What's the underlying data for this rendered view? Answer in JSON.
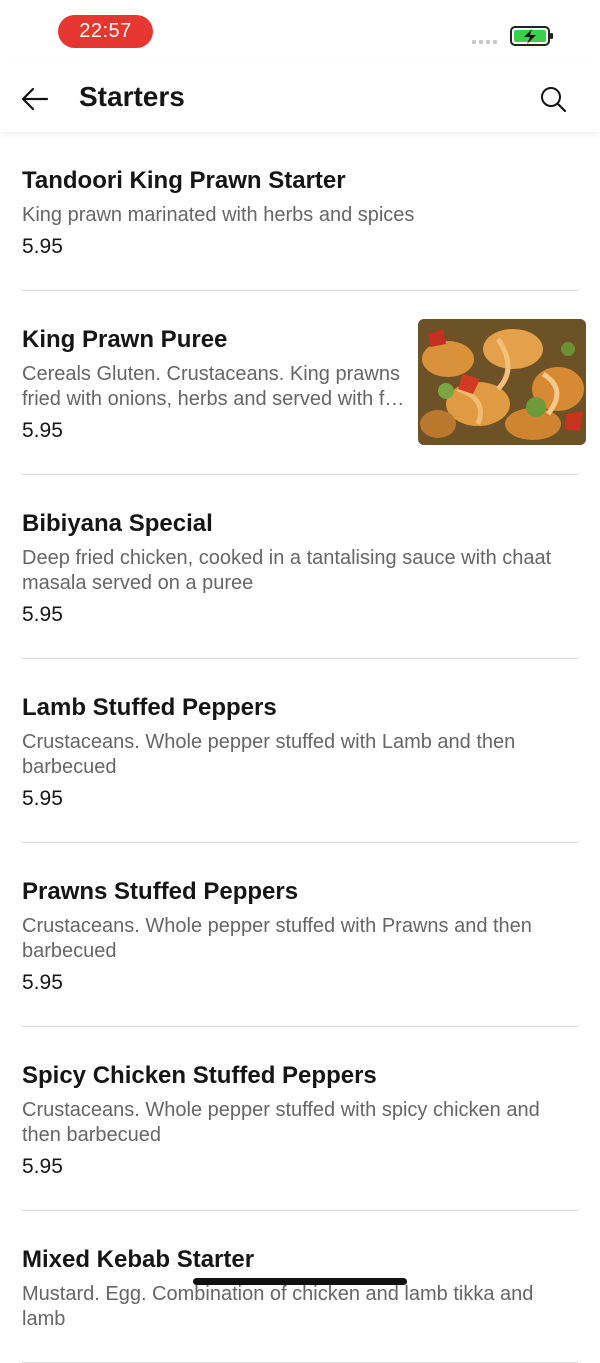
{
  "status_bar": {
    "time": "22:57"
  },
  "header": {
    "title": "Starters"
  },
  "items": [
    {
      "name": "Tandoori King Prawn Starter",
      "desc": "King prawn marinated with herbs and spices",
      "price": "5.95"
    },
    {
      "name": "King Prawn Puree",
      "desc_line1": "Cereals Gluten. Crustaceans. King prawns",
      "desc_line2": "fried with onions, herbs and served with f…",
      "price": "5.95"
    },
    {
      "name": "Bibiyana Special",
      "desc": "Deep fried chicken, cooked in a tantalising sauce with chaat masala served on a puree",
      "price": "5.95"
    },
    {
      "name": "Lamb Stuffed Peppers",
      "desc": "Crustaceans. Whole pepper stuffed with Lamb and then barbecued",
      "price": "5.95"
    },
    {
      "name": "Prawns Stuffed Peppers",
      "desc": "Crustaceans. Whole pepper stuffed with Prawns and then barbecued",
      "price": "5.95"
    },
    {
      "name": "Spicy Chicken Stuffed Peppers",
      "desc": "Crustaceans. Whole pepper stuffed with spicy chicken and then barbecued",
      "price": "5.95"
    },
    {
      "name": "Mixed Kebab Starter",
      "desc": "Mustard. Egg. Combination of chicken and lamb tikka and lamb",
      "price": ""
    }
  ],
  "colors": {
    "time_pill": "#e5362f",
    "battery_green": "#3ccf4e",
    "divider": "#d9d9d9"
  },
  "icons": {
    "back": "arrow-left-icon",
    "search": "search-icon",
    "battery": "battery-charging-icon"
  }
}
